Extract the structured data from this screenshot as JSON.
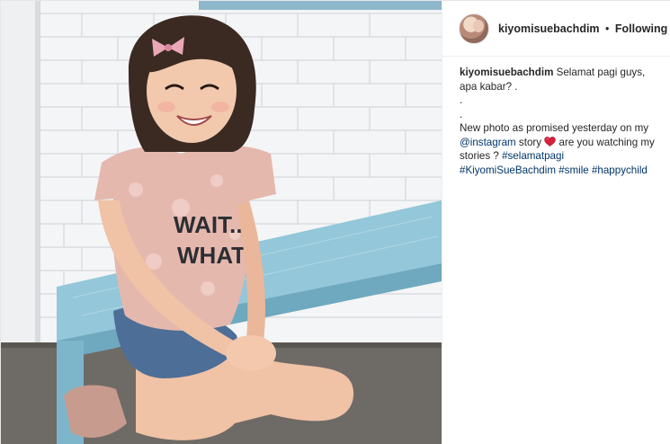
{
  "header": {
    "username": "kiyomisuebachdim",
    "separator": "•",
    "follow_status": "Following"
  },
  "caption": {
    "username": "kiyomisuebachdim",
    "line1": "Selamat pagi guys, apa kabar? .",
    "line2": ".",
    "line3": ".",
    "line4_start": "New photo as promised yesterday on my",
    "mention": "@instagram",
    "story_text": "story",
    "heart_icon": "red-heart-emoji",
    "after_heart": "are you watching my stories ?",
    "hashtags": [
      "#selamatpagi",
      "#KiyomiSueBachdim",
      "#smile",
      "#happychild"
    ]
  },
  "photo": {
    "shirt_text": "WAIT... WHAT?",
    "description_icon": "photo-of-smiling-child-on-blue-bench"
  },
  "colors": {
    "link": "#003569",
    "text": "#262626",
    "bench": "#8fc3d6",
    "wall": "#f2f4f6",
    "heart": "#d81f3c"
  }
}
